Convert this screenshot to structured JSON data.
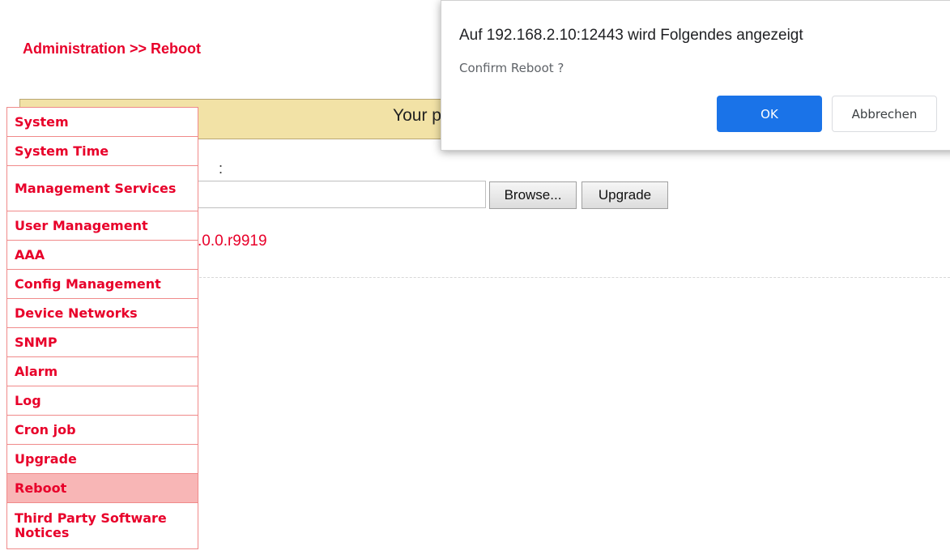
{
  "breadcrumb": "Administration >> Reboot",
  "banner": {
    "text": "Your p"
  },
  "upgrade_form": {
    "label_fragment": ":",
    "browse_label": "Browse...",
    "upgrade_label": "Upgrade",
    "version_fragment": ".0.0.r9919"
  },
  "sidebar": {
    "items": [
      {
        "label": "System"
      },
      {
        "label": "System Time"
      },
      {
        "label": "Management Services"
      },
      {
        "label": "User Management"
      },
      {
        "label": "AAA"
      },
      {
        "label": "Config Management"
      },
      {
        "label": "Device Networks"
      },
      {
        "label": "SNMP"
      },
      {
        "label": "Alarm"
      },
      {
        "label": "Log"
      },
      {
        "label": "Cron job"
      },
      {
        "label": "Upgrade"
      },
      {
        "label": "Reboot",
        "active": true
      },
      {
        "label": "Third Party Software Notices"
      }
    ]
  },
  "dialog": {
    "title": "Auf 192.168.2.10:12443 wird Folgendes angezeigt",
    "message": "Confirm Reboot ?",
    "ok_label": "OK",
    "cancel_label": "Abbrechen"
  },
  "colors": {
    "accent_red": "#e8002a",
    "active_item_bg": "#f8b6b6",
    "ok_button_blue": "#1a73e8",
    "banner_bg": "#f2e2a6"
  }
}
